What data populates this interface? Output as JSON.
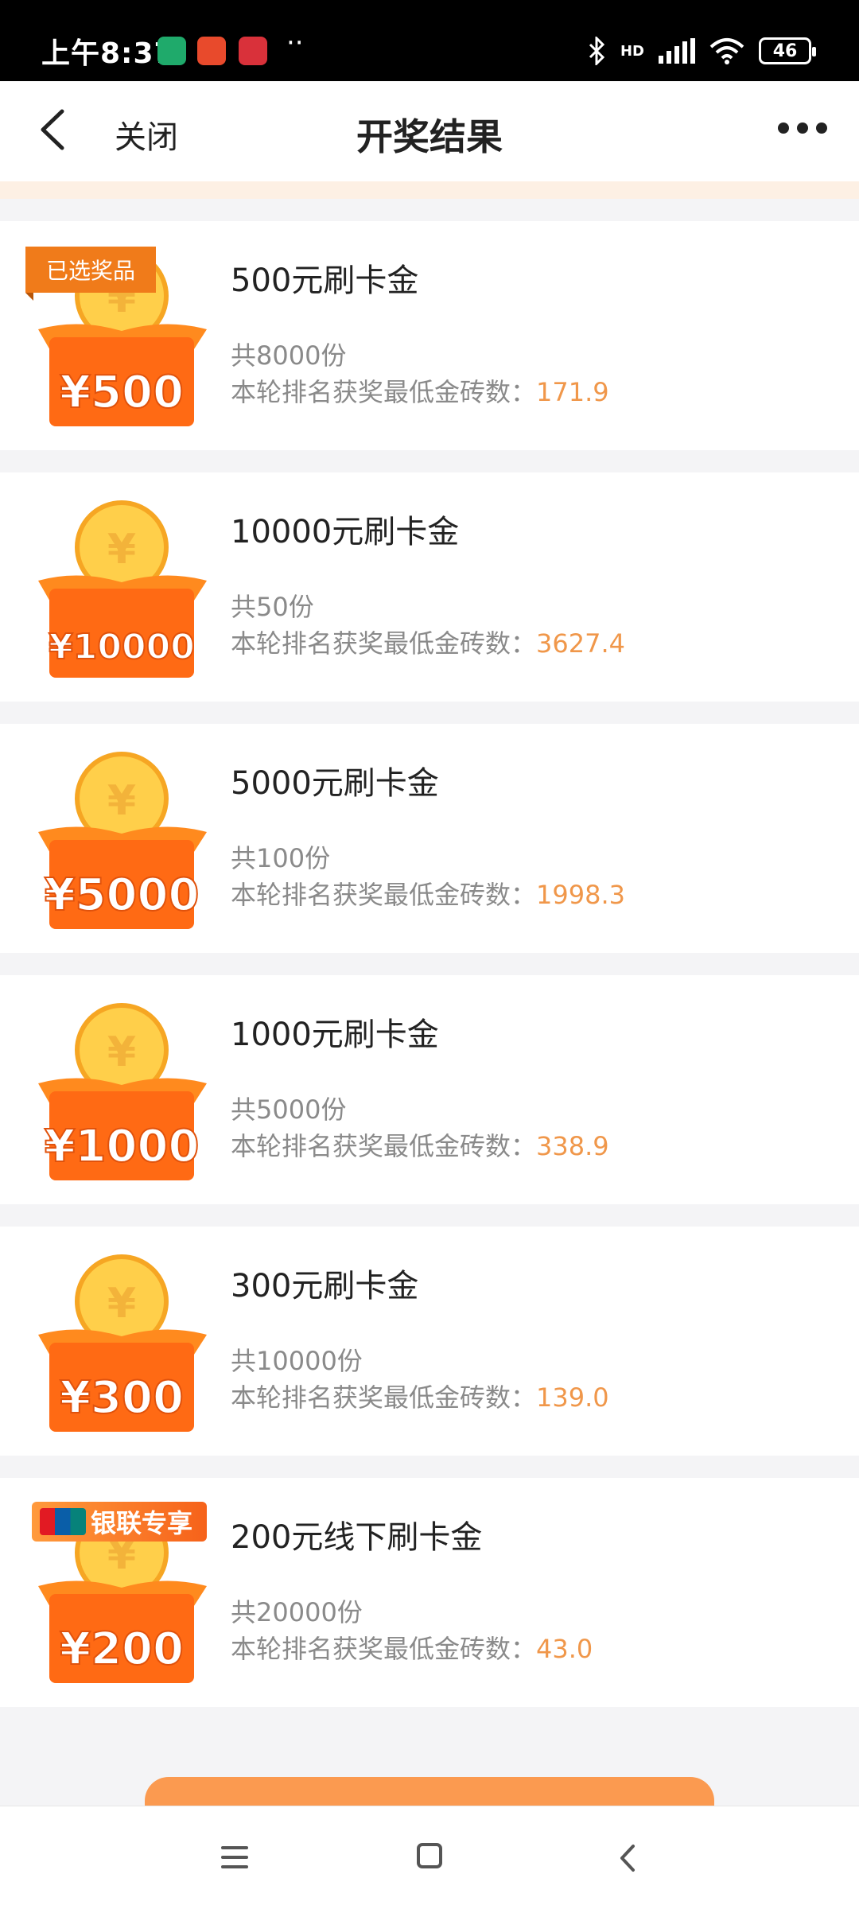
{
  "status_bar": {
    "time": "上午8:37",
    "dots": "··",
    "network": "HD",
    "battery": "46",
    "icons": [
      "app-shield-icon",
      "app-1111-icon",
      "app-kandian-icon",
      "bluetooth-icon",
      "signal-icon",
      "wifi-icon",
      "battery-icon"
    ]
  },
  "nav": {
    "close_label": "关闭",
    "title": "开奖结果",
    "icons": [
      "back-chevron-icon",
      "more-dots-icon"
    ]
  },
  "prizes": [
    {
      "name": "500元刷卡金",
      "count": "共8000份",
      "min_label": "本轮排名获奖最低金砖数：",
      "min_value": "171.9",
      "badge_amount": "¥500",
      "tag": "已选奖品"
    },
    {
      "name": "10000元刷卡金",
      "count": "共50份",
      "min_label": "本轮排名获奖最低金砖数：",
      "min_value": "3627.4",
      "badge_amount": "¥10000"
    },
    {
      "name": "5000元刷卡金",
      "count": "共100份",
      "min_label": "本轮排名获奖最低金砖数：",
      "min_value": "1998.3",
      "badge_amount": "¥5000"
    },
    {
      "name": "1000元刷卡金",
      "count": "共5000份",
      "min_label": "本轮排名获奖最低金砖数：",
      "min_value": "338.9",
      "badge_amount": "¥1000"
    },
    {
      "name": "300元刷卡金",
      "count": "共10000份",
      "min_label": "本轮排名获奖最低金砖数：",
      "min_value": "139.0",
      "badge_amount": "¥300"
    },
    {
      "name": "200元线下刷卡金",
      "count": "共20000份",
      "min_label": "本轮排名获奖最低金砖数：",
      "min_value": "43.0",
      "badge_amount": "¥200",
      "tag": "银联专享",
      "tag_logo_text": "UnionPay 银联"
    }
  ],
  "colors": {
    "accent_orange": "#f0974a",
    "tag_orange": "#f07b1a",
    "button_orange": "#fb9a50"
  },
  "system_nav": {
    "icons": [
      "menu-icon",
      "home-icon",
      "back-icon"
    ]
  }
}
